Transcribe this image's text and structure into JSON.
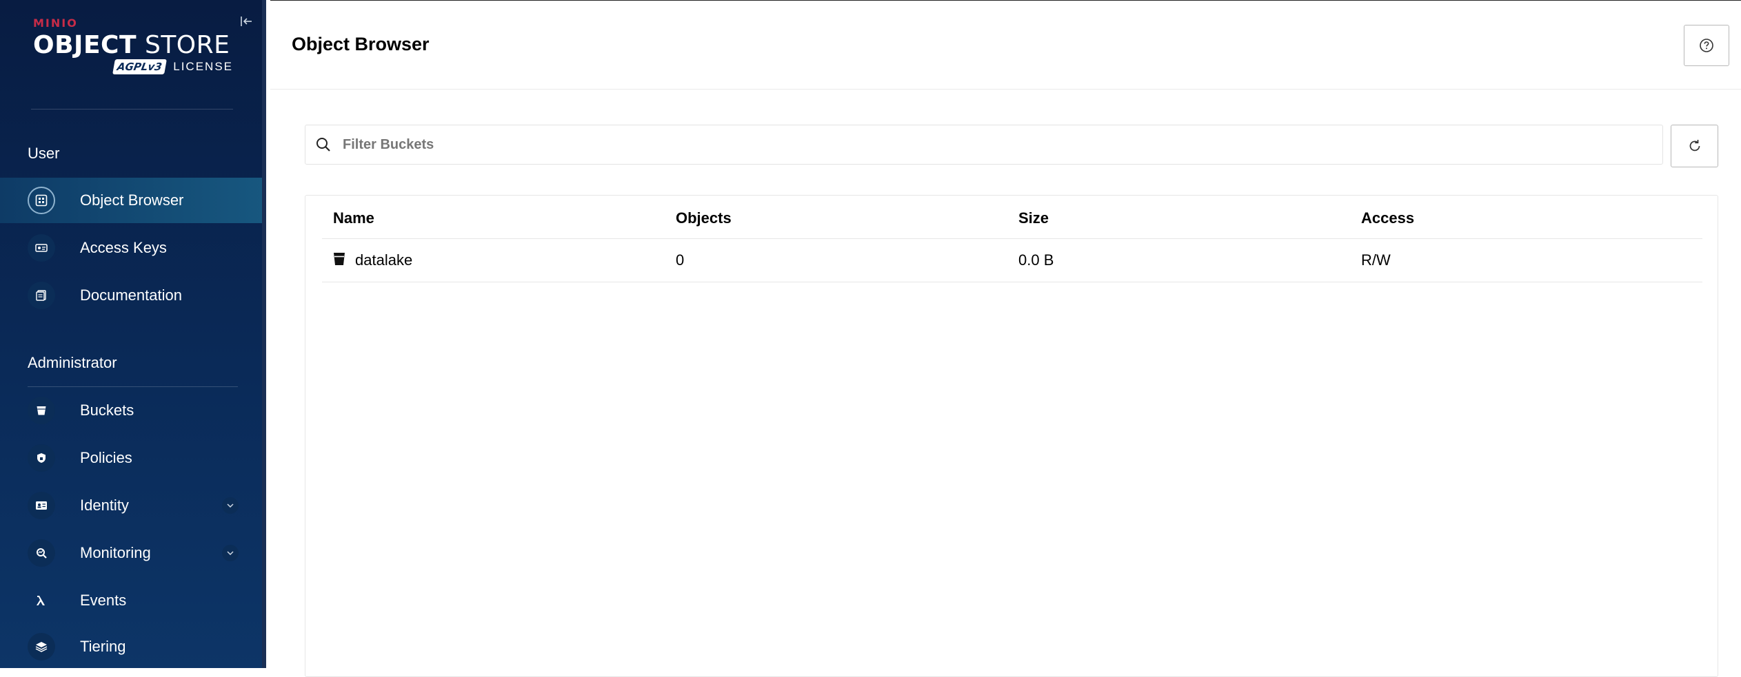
{
  "brand": {
    "vendor": "MINIO",
    "product_bold": "OBJECT",
    "product_light": "STORE",
    "license_badge": "AGPLv3",
    "license_text": "LICENSE"
  },
  "sidebar": {
    "user_section": "User",
    "user_items": [
      {
        "label": "Object Browser",
        "icon": "object-browser-icon",
        "active": true
      },
      {
        "label": "Access Keys",
        "icon": "access-keys-icon"
      },
      {
        "label": "Documentation",
        "icon": "documentation-icon"
      }
    ],
    "admin_section": "Administrator",
    "admin_items": [
      {
        "label": "Buckets",
        "icon": "bucket-icon"
      },
      {
        "label": "Policies",
        "icon": "policies-icon"
      },
      {
        "label": "Identity",
        "icon": "identity-icon",
        "expandable": true
      },
      {
        "label": "Monitoring",
        "icon": "monitoring-icon",
        "expandable": true
      },
      {
        "label": "Events",
        "icon": "lambda-icon"
      },
      {
        "label": "Tiering",
        "icon": "tiering-icon"
      }
    ]
  },
  "header": {
    "title": "Object Browser"
  },
  "search": {
    "placeholder": "Filter Buckets",
    "value": ""
  },
  "table": {
    "columns": [
      "Name",
      "Objects",
      "Size",
      "Access"
    ],
    "rows": [
      {
        "name": "datalake",
        "objects": "0",
        "size": "0.0 B",
        "access": "R/W"
      }
    ]
  },
  "colors": {
    "sidebar_bg": "#081c42",
    "brand_red": "#c72c48",
    "active_item": "#17577f"
  }
}
